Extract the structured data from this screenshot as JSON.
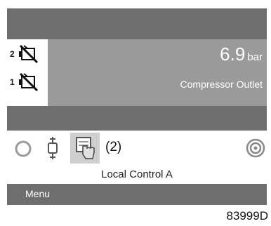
{
  "motors": [
    {
      "number": "2",
      "icon": "motor-stopped-icon"
    },
    {
      "number": "1",
      "icon": "motor-stopped-icon"
    }
  ],
  "pressure": {
    "value": "6.9",
    "unit": "bar",
    "label": "Compressor Outlet"
  },
  "icons": {
    "left": "circle-icon",
    "middle": "pressure-sensor-icon",
    "selected": "hand-touch-icon",
    "right": "spiral-icon"
  },
  "selection_marker": "(2)",
  "control_mode": "Local Control A",
  "menu": {
    "label": "Menu"
  },
  "figure_id": "83999D"
}
